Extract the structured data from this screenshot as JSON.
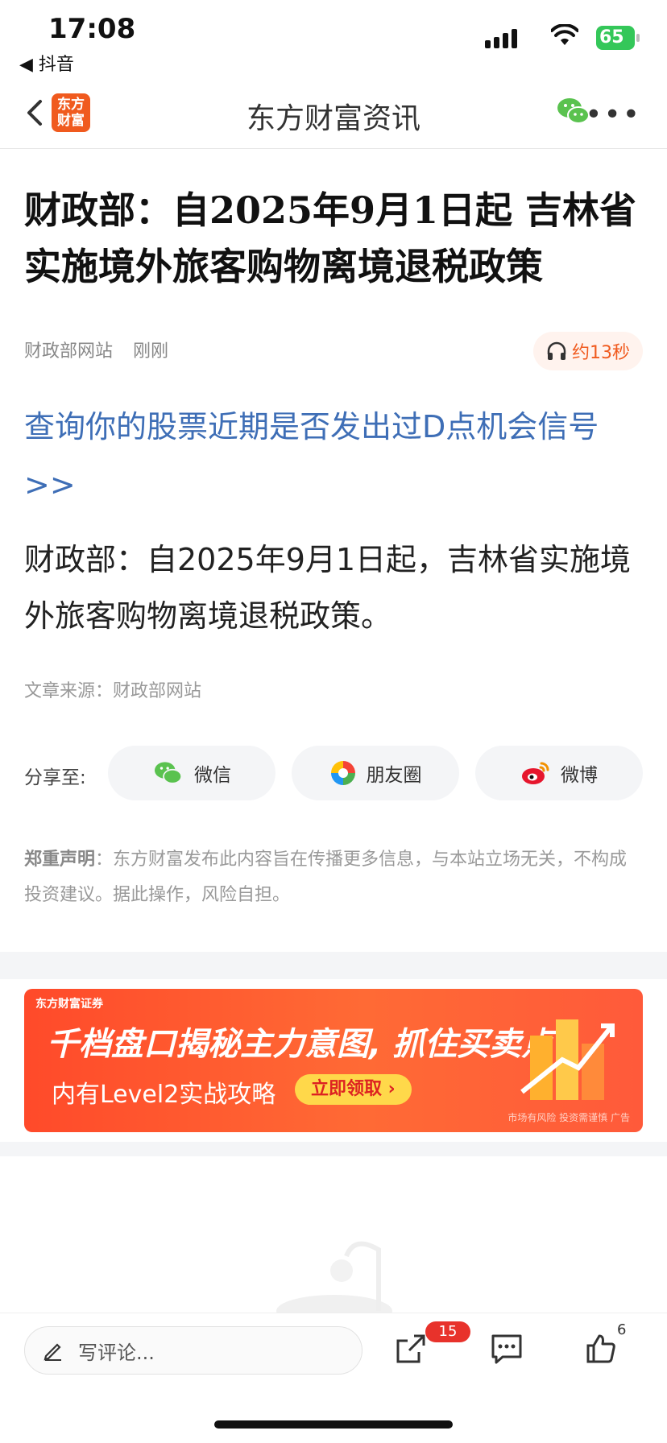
{
  "status_bar": {
    "time": "17:08",
    "back_app": "◀ 抖音",
    "battery": "65"
  },
  "nav": {
    "logo_line1": "东方",
    "logo_line2": "财富",
    "title": "东方财富资讯"
  },
  "article": {
    "headline": "财政部：自2025年9月1日起 吉林省实施境外旅客购物离境退税政策",
    "source_name": "财政部网站",
    "time": "刚刚",
    "listen_label": "约13秒",
    "promo_link": "查询你的股票近期是否发出过D点机会信号>>",
    "body": "财政部：自2025年9月1日起，吉林省实施境外旅客购物离境退税政策。",
    "source_line": "文章来源：财政部网站"
  },
  "share": {
    "label": "分享至:",
    "buttons": [
      {
        "label": "微信",
        "icon": "wechat-icon"
      },
      {
        "label": "朋友圈",
        "icon": "moments-icon"
      },
      {
        "label": "微博",
        "icon": "weibo-icon"
      }
    ]
  },
  "disclaimer": {
    "title": "郑重声明",
    "text": "：东方财富发布此内容旨在传播更多信息，与本站立场无关，不构成投资建议。据此操作，风险自担。"
  },
  "ad": {
    "brand": "东方财富证券",
    "title": "千档盘口揭秘主力意图, 抓住买卖点",
    "subtitle": "内有Level2实战攻略",
    "cta": "立即领取 ›",
    "risk": "市场有风险 投资需谨慎  广告"
  },
  "bottom_bar": {
    "comment_placeholder": "写评论...",
    "share_badge": "15",
    "like_count": "6"
  },
  "colors": {
    "brand": "#f05a1e",
    "link": "#3e6eb6",
    "badge": "#e8322b"
  }
}
